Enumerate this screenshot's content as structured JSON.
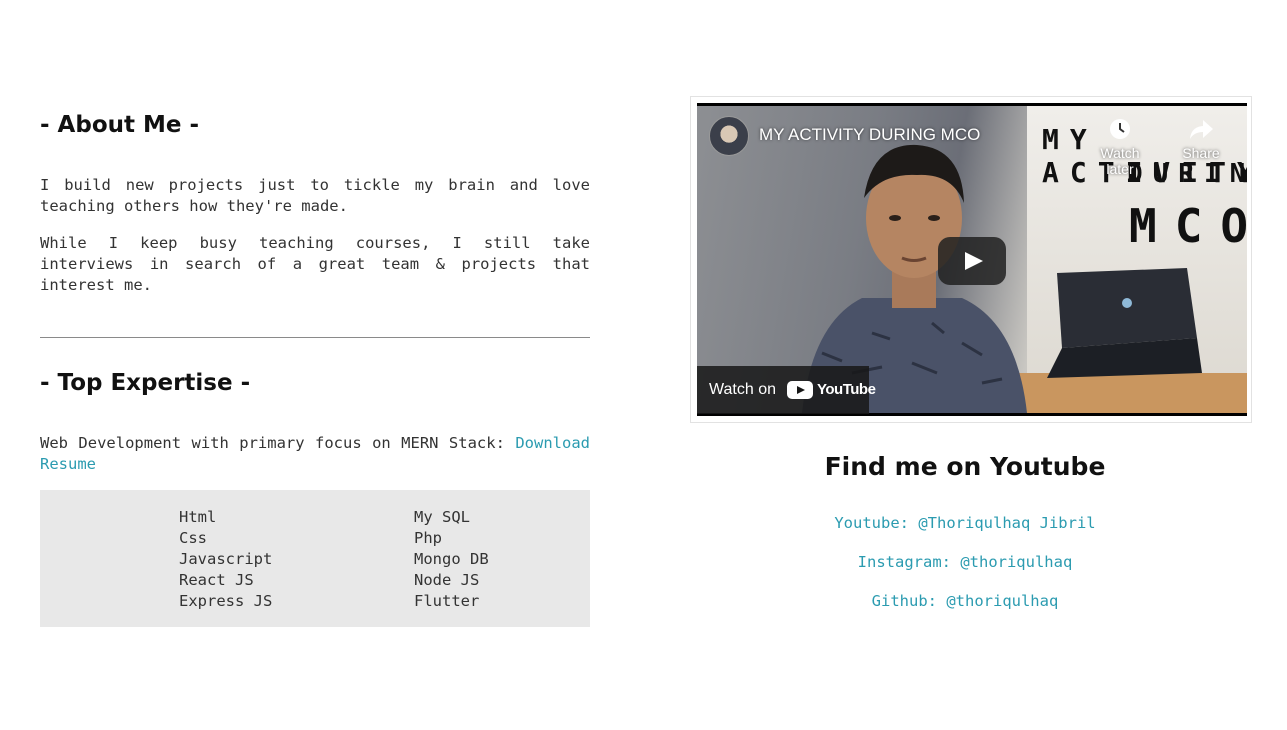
{
  "about": {
    "heading": "- About Me -",
    "paragraph1": "I build new projects just to tickle my brain and love teaching others how they're made.",
    "paragraph2": "While I keep busy teaching courses, I still take interviews in search of a great team & projects that interest me."
  },
  "expertise": {
    "heading": "- Top Expertise -",
    "intro": "Web Development with primary focus on MERN Stack:",
    "resume_link": "Download Resume",
    "skills_col1": [
      "Html",
      "Css",
      "Javascript",
      "React JS",
      "Express JS"
    ],
    "skills_col2": [
      "My SQL",
      "Php",
      "Mongo DB",
      "Node JS",
      "Flutter"
    ]
  },
  "video": {
    "title": "MY ACTIVITY DURING MCO",
    "overlay_line1": "MY ACTIVITY",
    "overlay_line2": "DURING",
    "overlay_line3": "MCO",
    "watch_later_label": "Watch later",
    "share_label": "Share",
    "watch_on_label": "Watch on",
    "youtube_logo_text": "YouTube",
    "play_icon": "play-icon",
    "clock_icon": "clock-icon",
    "share_icon": "share-arrow-icon"
  },
  "youtube_section": {
    "heading": "Find me on Youtube",
    "youtube_link": "Youtube: @Thoriqulhaq Jibril",
    "instagram_link": "Instagram: @thoriqulhaq",
    "github_link": "Github: @thoriqulhaq"
  },
  "colors": {
    "link": "#2b9bb0",
    "skills_background": "#e8e8e8",
    "heading": "#111111",
    "youtube_red": "#ff0000"
  }
}
